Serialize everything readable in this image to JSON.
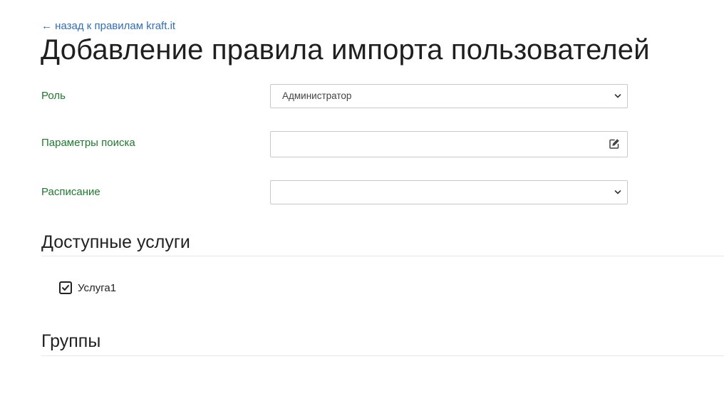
{
  "header": {
    "back_link": "← назад к правилам kraft.it",
    "title": "Добавление правила импорта пользователей"
  },
  "form": {
    "role": {
      "label": "Роль",
      "value": "Администратор"
    },
    "search_params": {
      "label": "Параметры поиска",
      "value": "",
      "icon": "edit-icon"
    },
    "schedule": {
      "label": "Расписание",
      "value": ""
    }
  },
  "services": {
    "title": "Доступные услуги",
    "items": [
      {
        "label": "Услуга1",
        "checked": true
      }
    ]
  },
  "groups": {
    "title": "Группы"
  },
  "colors": {
    "link": "#2f6fbd",
    "label": "#1e7a2e",
    "text": "#222222",
    "border": "#c8c8c8"
  }
}
